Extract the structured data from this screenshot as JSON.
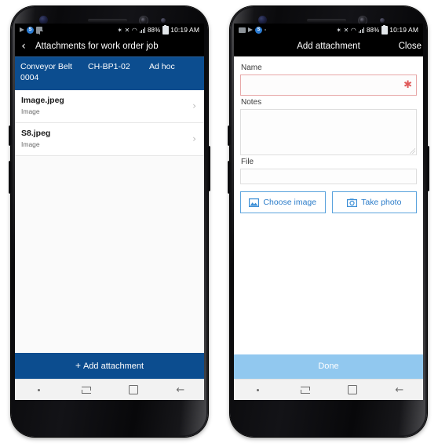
{
  "colors": {
    "brand_blue": "#0c4d8f",
    "done_blue": "#91c8ef",
    "link_blue": "#2b7cc9",
    "required_red": "#e05a5a",
    "statusbar_bg": "#000000"
  },
  "status_bar": {
    "time": "10:19 AM",
    "battery": "88%",
    "left_icons": [
      "play-store-icon",
      "skype-icon",
      "document-icon"
    ],
    "left_icons_right_phone": [
      "image-icon",
      "play-store-icon",
      "skype-icon",
      "dot-icon"
    ],
    "right_icons": [
      "bluetooth-icon",
      "mute-icon",
      "wifi-icon",
      "signal-icon",
      "battery-icon"
    ],
    "bluetooth_glyph": "✶",
    "mute_glyph": "✕",
    "wifi_glyph": "◠"
  },
  "left_phone": {
    "app_bar": {
      "back_label": "‹",
      "title": "Attachments for work order job"
    },
    "work_order": {
      "asset": "Conveyor Belt",
      "code": "CH-BP1-02",
      "type": "Ad hoc",
      "number": "0004"
    },
    "attachments": [
      {
        "name": "Image.jpeg",
        "type": "Image",
        "chevron": "›"
      },
      {
        "name": "S8.jpeg",
        "type": "Image",
        "chevron": "›"
      }
    ],
    "add_button": {
      "plus": "+",
      "label": "Add attachment"
    }
  },
  "right_phone": {
    "app_bar": {
      "title": "Add attachment",
      "close_label": "Close"
    },
    "form": {
      "name_label": "Name",
      "name_value": "",
      "name_required_marker": "✱",
      "notes_label": "Notes",
      "notes_value": "",
      "file_label": "File",
      "file_value": "",
      "choose_image_label": "Choose image",
      "take_photo_label": "Take photo"
    },
    "done_button": {
      "label": "Done"
    }
  },
  "nav_bar": {
    "items": [
      "dot-indicator",
      "recents-icon",
      "home-icon",
      "back-icon"
    ],
    "back_glyph": "←"
  }
}
